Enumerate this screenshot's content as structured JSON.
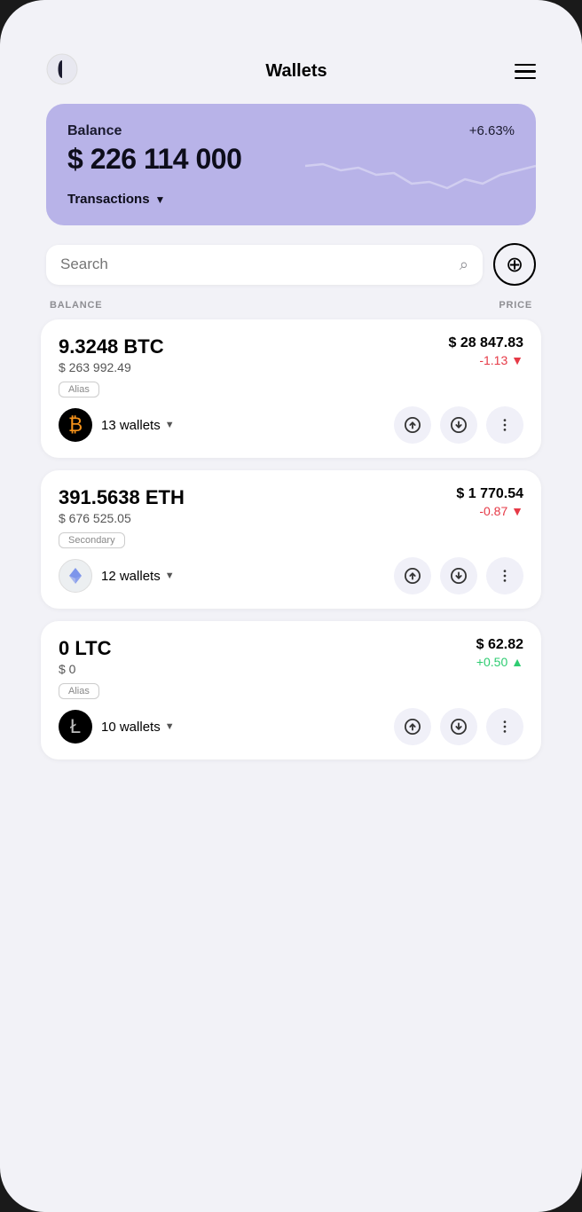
{
  "header": {
    "title": "Wallets",
    "logo_alt": "app-logo",
    "menu_alt": "menu"
  },
  "balance_card": {
    "label": "Balance",
    "change": "+6.63%",
    "amount": "$ 226 114 000",
    "transactions_label": "Transactions"
  },
  "search": {
    "placeholder": "Search",
    "add_alt": "add"
  },
  "table_headers": {
    "balance": "BALANCE",
    "price": "PRICE"
  },
  "coins": [
    {
      "id": "btc",
      "name": "9.3248 BTC",
      "usd_value": "$ 263 992.49",
      "price": "$ 28 847.83",
      "change": "-1.13",
      "change_dir": "neg",
      "alias": "Alias",
      "wallets": "13 wallets",
      "symbol": "₿",
      "logo_type": "btc"
    },
    {
      "id": "eth",
      "name": "391.5638 ETH",
      "usd_value": "$ 676 525.05",
      "price": "$ 1 770.54",
      "change": "-0.87",
      "change_dir": "neg",
      "alias": "Secondary",
      "wallets": "12 wallets",
      "symbol": "Ξ",
      "logo_type": "eth"
    },
    {
      "id": "ltc",
      "name": "0 LTC",
      "usd_value": "$ 0",
      "price": "$ 62.82",
      "change": "+0.50",
      "change_dir": "pos",
      "alias": "Alias",
      "wallets": "10 wallets",
      "symbol": "Ł",
      "logo_type": "ltc"
    }
  ],
  "colors": {
    "balance_card_bg": "#b8b3e8",
    "neg_change": "#e63946",
    "pos_change": "#2ecc71"
  }
}
